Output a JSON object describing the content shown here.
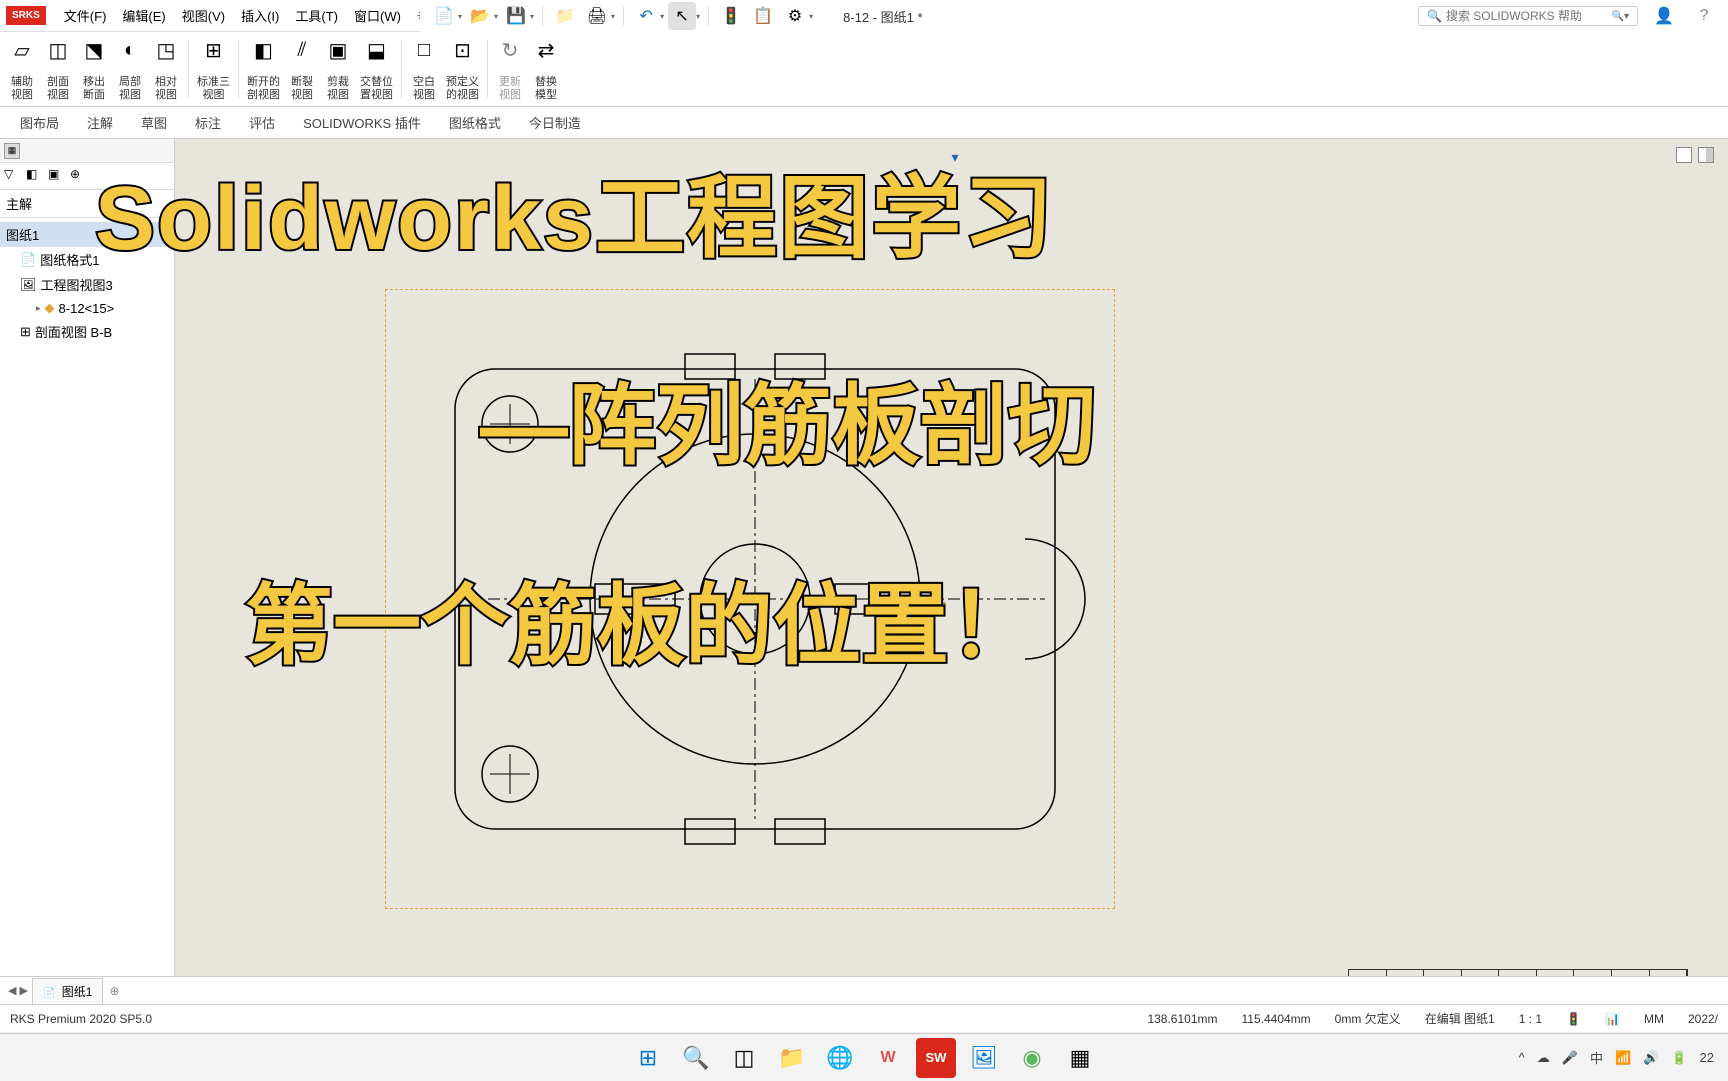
{
  "app": {
    "logo": "SRKS",
    "title": "8-12 - 图纸1 *",
    "search_placeholder": "搜索 SOLIDWORKS 帮助"
  },
  "menubar": {
    "items": [
      "文件(F)",
      "编辑(E)",
      "视图(V)",
      "插入(I)",
      "工具(T)",
      "窗口(W)"
    ]
  },
  "ribbon": {
    "buttons": [
      {
        "label": "辅助\n视图",
        "icon": "▱"
      },
      {
        "label": "剖面\n视图",
        "icon": "◫"
      },
      {
        "label": "移出\n断面",
        "icon": "⬔"
      },
      {
        "label": "局部\n视图",
        "icon": "◐"
      },
      {
        "label": "相对\n视图",
        "icon": "◳"
      },
      {
        "label": "标准三\n视图",
        "icon": "⊞"
      },
      {
        "label": "断开的\n剖视图",
        "icon": "◧"
      },
      {
        "label": "断裂\n视图",
        "icon": "⫽"
      },
      {
        "label": "剪裁\n视图",
        "icon": "▣"
      },
      {
        "label": "交替位\n置视图",
        "icon": "⬓"
      },
      {
        "label": "空白\n视图",
        "icon": "□"
      },
      {
        "label": "预定义\n的视图",
        "icon": "⊡"
      },
      {
        "label": "更新\n视图",
        "icon": "↻"
      },
      {
        "label": "替换\n模型",
        "icon": "⇄"
      }
    ]
  },
  "tabs": {
    "items": [
      "图布局",
      "注解",
      "草图",
      "标注",
      "评估",
      "SOLIDWORKS 插件",
      "图纸格式",
      "今日制造"
    ]
  },
  "tree": {
    "header": "主解",
    "items": [
      {
        "label": "图纸1",
        "icon": "",
        "indent": 0,
        "selected": true
      },
      {
        "label": "图纸格式1",
        "icon": "📄",
        "indent": 1
      },
      {
        "label": "工程图视图3",
        "icon": "🖼",
        "indent": 1
      },
      {
        "label": "8-12<15>",
        "icon": "🟡",
        "indent": 2
      },
      {
        "label": "剖面视图 B-B",
        "icon": "⊞",
        "indent": 1
      }
    ]
  },
  "overlay": {
    "line1": "Solidworks工程图学习",
    "line2": "—阵列筋板剖切",
    "line3": "第一个筋板的位置！"
  },
  "bottom_tab": "图纸1",
  "statusbar": {
    "product": "RKS Premium 2020 SP5.0",
    "x": "138.6101mm",
    "y": "115.4404mm",
    "z": "0mm",
    "state": "欠定义",
    "editing": "在编辑 图纸1",
    "scale": "1 : 1",
    "units": "MM",
    "date": "2022/"
  },
  "taskbar": {
    "tray": {
      "ime": "中",
      "time": "22"
    }
  }
}
